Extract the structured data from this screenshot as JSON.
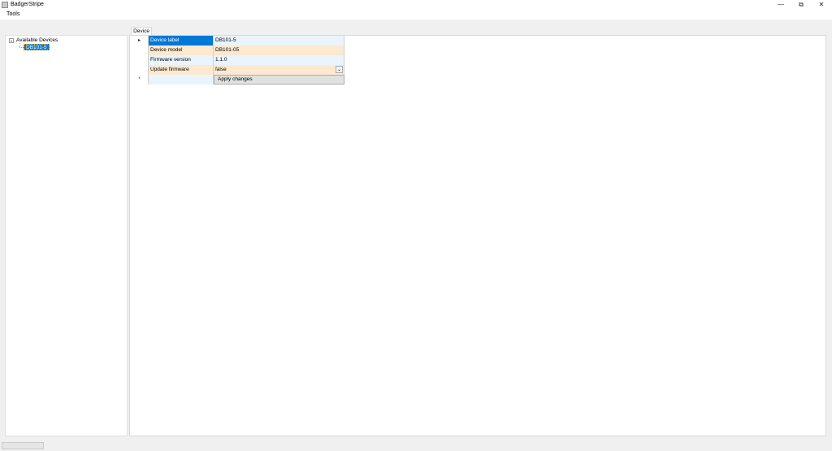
{
  "window": {
    "title": "BadgerStripe",
    "minimize_glyph": "—",
    "restore_glyph": "⧉",
    "close_glyph": "✕"
  },
  "menu": {
    "tools": "Tools"
  },
  "tree": {
    "root_label": "Available Devices",
    "children": [
      "DB101-5"
    ],
    "selected": "DB101-5"
  },
  "tabs": {
    "device": "Device"
  },
  "device_grid": {
    "rows": [
      {
        "name": "Device label",
        "value": "DB101-5"
      },
      {
        "name": "Device model",
        "value": "DB101-05"
      },
      {
        "name": "Firmware version",
        "value": "1.1.0"
      },
      {
        "name": "Update firmware",
        "value": "false"
      }
    ],
    "current_row_marker": "▸",
    "new_row_marker": "*",
    "apply_label": "Apply changes"
  },
  "colors": {
    "selection": "#0078d7",
    "row_blue": "#eaf4fc",
    "row_orange": "#fde9d0"
  }
}
